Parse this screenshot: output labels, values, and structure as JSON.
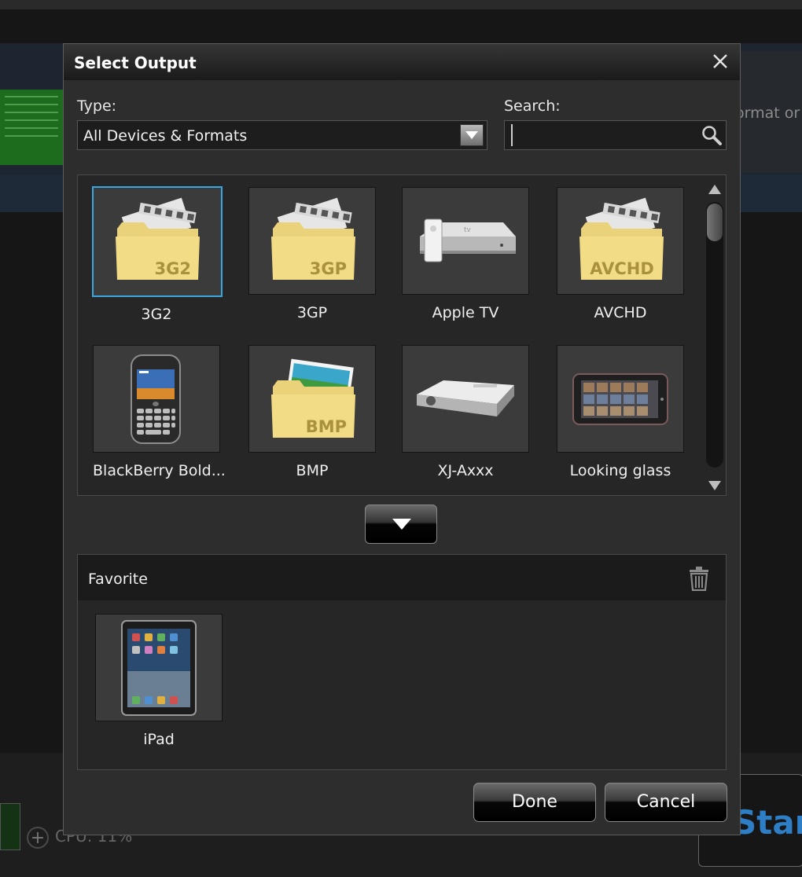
{
  "background": {
    "format_text": "ormat or",
    "cpu_text": "CPU: 11%",
    "start_text": "Start"
  },
  "dialog": {
    "title": "Select Output",
    "type_label": "Type:",
    "type_value": "All Devices & Formats",
    "search_label": "Search:",
    "search_value": ""
  },
  "outputs": [
    {
      "label": "3G2",
      "icon": "folder-3g2-icon",
      "badge": "3G2",
      "selected": true
    },
    {
      "label": "3GP",
      "icon": "folder-3gp-icon",
      "badge": "3GP",
      "selected": false
    },
    {
      "label": "Apple TV",
      "icon": "apple-tv-icon",
      "selected": false
    },
    {
      "label": "AVCHD",
      "icon": "folder-avchd-icon",
      "badge": "AVCHD",
      "selected": false
    },
    {
      "label": "BlackBerry Bold...",
      "icon": "blackberry-phone-icon",
      "selected": false
    },
    {
      "label": "BMP",
      "icon": "folder-bmp-icon",
      "badge": "BMP",
      "selected": false
    },
    {
      "label": "XJ-Axxx",
      "icon": "projector-icon",
      "selected": false
    },
    {
      "label": "Looking glass",
      "icon": "tablet-device-icon",
      "selected": false
    }
  ],
  "favorite": {
    "title": "Favorite",
    "items": [
      {
        "label": "iPad",
        "icon": "ipad-icon"
      }
    ]
  },
  "buttons": {
    "done": "Done",
    "cancel": "Cancel"
  },
  "colors": {
    "selection": "#3aa8e0",
    "folder": "#e9d27a",
    "dialog_bg": "#2d2d2d"
  }
}
